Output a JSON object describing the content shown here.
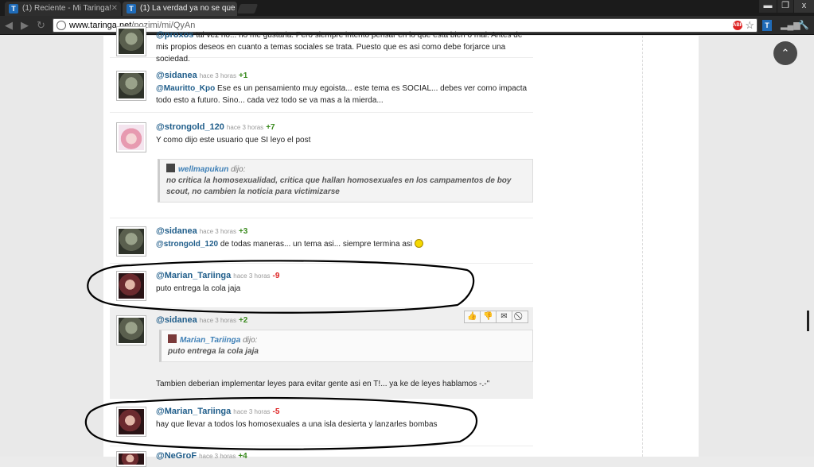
{
  "browser": {
    "tabs": [
      {
        "label": "(1) Reciente - Mi Taringa!",
        "icon": "T"
      },
      {
        "label": "(1) La verdad ya no se que",
        "icon": "T"
      }
    ],
    "url_host": "www.taringa.net",
    "url_path": "/pozimi/mi/QyAn",
    "window_controls": {
      "minimize": "▬",
      "maximize": "❐",
      "close": "x"
    },
    "adblock_label": "ABP",
    "extension_icon": "T"
  },
  "comments": [
    {
      "user": "@proxos",
      "time": "",
      "score": "",
      "text": "tal vez no... no me gustaria. Pero siempre intento pensar en lo que esta bien o mal. Antes de mis propios deseos en cuanto a temas sociales se trata. Puesto que es asi como debe forjarce una sociedad."
    },
    {
      "user": "@sidanea",
      "time": "hace 3 horas",
      "score": "+1",
      "mention": "@Mauritto_Kpo",
      "text": "Ese es un pensamiento muy egoista... este tema es SOCIAL... debes ver como impacta todo esto a futuro. Sino... cada vez todo se va mas a la mierda..."
    },
    {
      "user": "@strongold_120",
      "time": "hace 3 horas",
      "score": "+7",
      "text": "Y como dijo este usuario que SI leyo el post",
      "quote_user": "wellmapukun",
      "quote_dijo": "dijo:",
      "quote_text": "no critica la homosexualidad, critica que hallan homosexuales en los campamentos de boy scout, no cambien la noticia para victimizarse"
    },
    {
      "user": "@sidanea",
      "time": "hace 3 horas",
      "score": "+3",
      "mention": "@strongold_120",
      "text": "de todas maneras... un tema asi... siempre termina asi"
    },
    {
      "user": "@Marian_Tariinga",
      "time": "hace 3 horas",
      "score": "-9",
      "text": "puto entrega la cola jaja"
    },
    {
      "user": "@sidanea",
      "time": "hace 3 horas",
      "score": "+2",
      "quote_user": "Marian_Tariinga",
      "quote_dijo": "dijo:",
      "quote_text": "puto entrega la cola jaja",
      "text": "Tambien deberian implementar leyes para evitar gente asi en T!... ya ke de leyes hablamos -.-\"",
      "actions": [
        "👍",
        "👎",
        "✉",
        "⃠"
      ]
    },
    {
      "user": "@Marian_Tariinga",
      "time": "hace 3 horas",
      "score": "-5",
      "text": "hay que llevar a todos los homosexuales a una isla desierta y lanzarles bombas"
    },
    {
      "user": "@NeGroF",
      "time": "hace 3 horas",
      "score": "+4",
      "text": ""
    }
  ],
  "scroll_top_icon": "⌃"
}
